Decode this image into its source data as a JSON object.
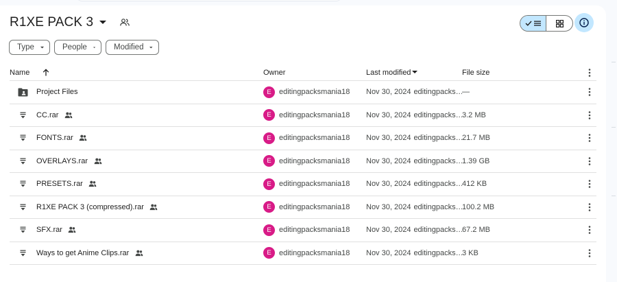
{
  "header": {
    "title": "R1XE PACK 3",
    "view_toggle": {
      "list_active": true
    }
  },
  "filters": [
    {
      "label": "Type"
    },
    {
      "label": "People"
    },
    {
      "label": "Modified"
    }
  ],
  "table": {
    "columns": {
      "name": "Name",
      "owner": "Owner",
      "last_modified": "Last modified",
      "file_size": "File size"
    },
    "rows": [
      {
        "name": "Project Files",
        "type": "folder",
        "shared": false,
        "owner_initial": "E",
        "owner": "editingpacksmania18",
        "date": "Nov 30, 2024",
        "by": "editingpacks…",
        "size": "—"
      },
      {
        "name": "CC.rar",
        "type": "archive",
        "shared": true,
        "owner_initial": "E",
        "owner": "editingpacksmania18",
        "date": "Nov 30, 2024",
        "by": "editingpacks…",
        "size": "3.2 MB"
      },
      {
        "name": "FONTS.rar",
        "type": "archive",
        "shared": true,
        "owner_initial": "E",
        "owner": "editingpacksmania18",
        "date": "Nov 30, 2024",
        "by": "editingpacks…",
        "size": "21.7 MB"
      },
      {
        "name": "OVERLAYS.rar",
        "type": "archive",
        "shared": true,
        "owner_initial": "E",
        "owner": "editingpacksmania18",
        "date": "Nov 30, 2024",
        "by": "editingpacks…",
        "size": "1.39 GB"
      },
      {
        "name": "PRESETS.rar",
        "type": "archive",
        "shared": true,
        "owner_initial": "E",
        "owner": "editingpacksmania18",
        "date": "Nov 30, 2024",
        "by": "editingpacks…",
        "size": "412 KB"
      },
      {
        "name": "R1XE PACK 3 (compressed).rar",
        "type": "archive",
        "shared": true,
        "owner_initial": "E",
        "owner": "editingpacksmania18",
        "date": "Nov 30, 2024",
        "by": "editingpacks…",
        "size": "100.2 MB"
      },
      {
        "name": "SFX.rar",
        "type": "archive",
        "shared": true,
        "owner_initial": "E",
        "owner": "editingpacksmania18",
        "date": "Nov 30, 2024",
        "by": "editingpacks…",
        "size": "67.2 MB"
      },
      {
        "name": "Ways to get Anime Clips.rar",
        "type": "archive",
        "shared": true,
        "owner_initial": "E",
        "owner": "editingpacksmania18",
        "date": "Nov 30, 2024",
        "by": "editingpacks…",
        "size": "3 KB"
      }
    ]
  },
  "icons": {
    "folder": "shared-folder-icon",
    "archive": "archive-file-icon",
    "shared": "people-icon",
    "more": "more-vert-icon",
    "info": "info-icon",
    "list_view": "list-view-icon",
    "grid_view": "grid-view-icon"
  },
  "colors": {
    "accent": "#c2e7ff",
    "avatar": "#d81b87",
    "text": "#1f1f1f",
    "muted": "#444746",
    "divider": "#e0e0e0"
  }
}
